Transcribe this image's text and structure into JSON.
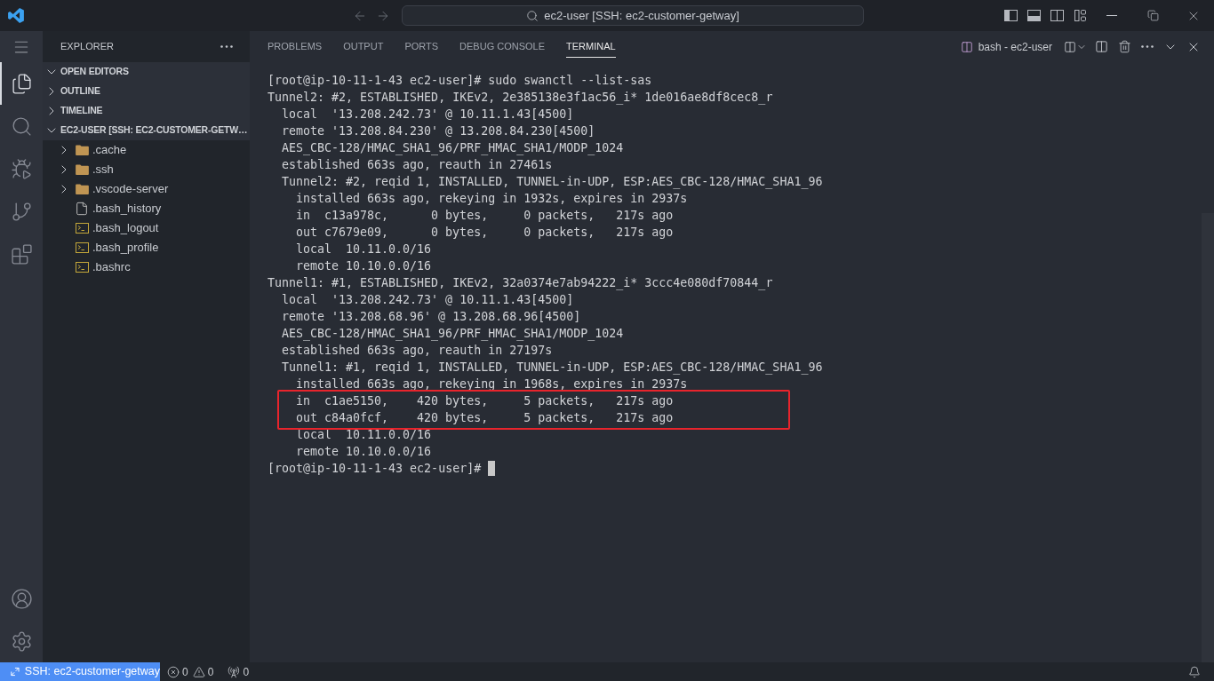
{
  "title_bar": {
    "command_center": "ec2-user [SSH: ec2-customer-getway]"
  },
  "activity_bar": {
    "items": [
      {
        "selected": true
      },
      {
        "selected": false
      },
      {
        "selected": false
      },
      {
        "selected": false
      },
      {
        "selected": false
      }
    ]
  },
  "sidebar": {
    "title": "EXPLORER",
    "sections": [
      {
        "label": "OPEN EDITORS",
        "expanded": true
      },
      {
        "label": "OUTLINE",
        "expanded": false
      },
      {
        "label": "TIMELINE",
        "expanded": false
      },
      {
        "label": "EC2-USER [SSH: EC2-CUSTOMER-GETW…",
        "expanded": true,
        "files": [
          {
            "name": ".cache",
            "kind": "folder",
            "expanded": false
          },
          {
            "name": ".ssh",
            "kind": "folder",
            "expanded": false
          },
          {
            "name": ".vscode-server",
            "kind": "folder",
            "expanded": false
          },
          {
            "name": ".bash_history",
            "kind": "file"
          },
          {
            "name": ".bash_logout",
            "kind": "shell"
          },
          {
            "name": ".bash_profile",
            "kind": "shell"
          },
          {
            "name": ".bashrc",
            "kind": "shell"
          }
        ]
      }
    ]
  },
  "panel": {
    "tabs": [
      {
        "label": "PROBLEMS",
        "selected": false
      },
      {
        "label": "OUTPUT",
        "selected": false
      },
      {
        "label": "PORTS",
        "selected": false
      },
      {
        "label": "DEBUG CONSOLE",
        "selected": false
      },
      {
        "label": "TERMINAL",
        "selected": true
      }
    ],
    "terminal_name": "bash - ec2-user",
    "terminal": {
      "lines": [
        {
          "text": "[root@ip-10-11-1-43 ec2-user]# sudo swanctl --list-sas",
          "cursor": false
        },
        {
          "text": "Tunnel2: #2, ESTABLISHED, IKEv2, 2e385138e3f1ac56_i* 1de016ae8df8cec8_r",
          "cursor": false,
          "children": [
            {
              "text": "local  '13.208.242.73' @ 10.11.1.43[4500]"
            },
            {
              "text": "remote '13.208.84.230' @ 13.208.84.230[4500]"
            },
            {
              "text": "AES_CBC-128/HMAC_SHA1_96/PRF_HMAC_SHA1/MODP_1024"
            },
            {
              "text": "established 663s ago, reauth in 27461s"
            },
            {
              "text": "Tunnel2: #2, reqid 1, INSTALLED, TUNNEL-in-UDP, ESP:AES_CBC-128/HMAC_SHA1_96",
              "children": [
                {
                  "text": "installed 663s ago, rekeying in 1932s, expires in 2937s"
                },
                {
                  "text": "in  c13a978c,      0 bytes,     0 packets,   217s ago"
                },
                {
                  "text": "out c7679e09,      0 bytes,     0 packets,   217s ago"
                },
                {
                  "text": "local  10.11.0.0/16"
                },
                {
                  "text": "remote 10.10.0.0/16"
                }
              ]
            }
          ]
        },
        {
          "text": "Tunnel1: #1, ESTABLISHED, IKEv2, 32a0374e7ab94222_i* 3ccc4e080df70844_r",
          "cursor": false,
          "children": [
            {
              "text": "local  '13.208.242.73' @ 10.11.1.43[4500]"
            },
            {
              "text": "remote '13.208.68.96' @ 13.208.68.96[4500]"
            },
            {
              "text": "AES_CBC-128/HMAC_SHA1_96/PRF_HMAC_SHA1/MODP_1024"
            },
            {
              "text": "established 663s ago, reauth in 27197s"
            },
            {
              "text": "Tunnel1: #1, reqid 1, INSTALLED, TUNNEL-in-UDP, ESP:AES_CBC-128/HMAC_SHA1_96",
              "children": [
                {
                  "text": "installed 663s ago, rekeying in 1968s, expires in 2937s",
                  "highlighted": false
                },
                {
                  "text": "in  c1ae5150,    420 bytes,     5 packets,   217s ago",
                  "highlighted": true
                },
                {
                  "text": "out c84a0fcf,    420 bytes,     5 packets,   217s ago",
                  "highlighted": true
                },
                {
                  "text": "local  10.11.0.0/16",
                  "highlighted": false
                },
                {
                  "text": "remote 10.10.0.0/16",
                  "highlighted": false
                }
              ]
            }
          ]
        },
        {
          "text": "[root@ip-10-11-1-43 ec2-user]#",
          "cursor": true
        }
      ]
    }
  },
  "status_bar": {
    "remote": "SSH: ec2-customer-getway",
    "errors": "0",
    "warnings": "0",
    "ports": "0"
  }
}
